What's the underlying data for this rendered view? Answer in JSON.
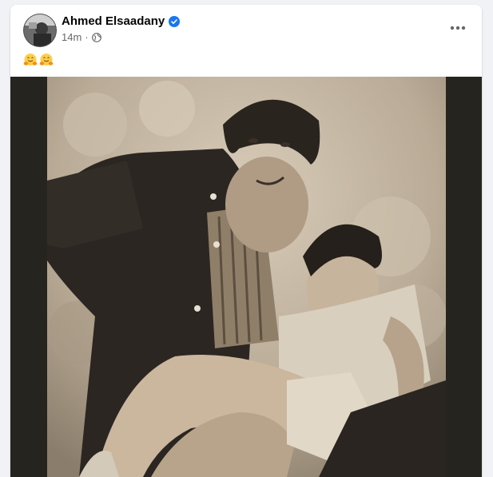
{
  "post": {
    "author": {
      "name": "Ahmed Elsaadany",
      "verified": true,
      "avatar_icon": "profile-photo"
    },
    "timestamp": "14m",
    "separator": "·",
    "privacy_icon": "globe-icon",
    "text_emojis": [
      "hugging-face-emoji",
      "hugging-face-emoji"
    ],
    "more_icon": "more-options-icon",
    "photo": {
      "description_icon": "vintage-sepia-photo",
      "style": "sepia"
    }
  },
  "colors": {
    "verified_badge": "#1877f2",
    "secondary_text": "#65676b",
    "page_bg": "#f0f2f5",
    "media_bg": "#25241f",
    "emoji_yellow": "#ffcc4d"
  }
}
